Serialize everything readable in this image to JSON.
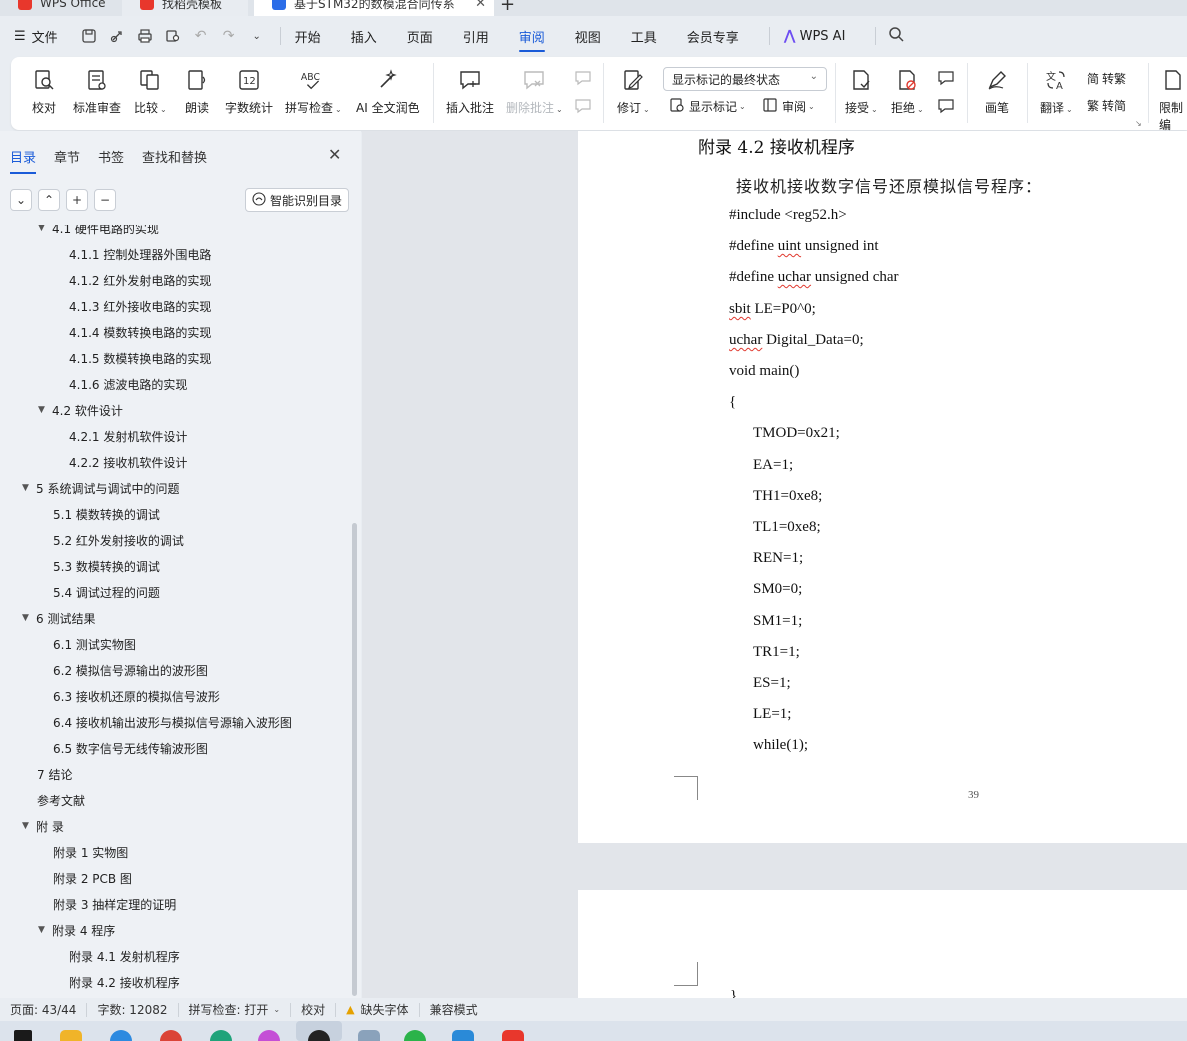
{
  "titlebar": {
    "tabs": [
      {
        "label": "WPS Office",
        "color": "#e8372c"
      },
      {
        "label": "找稻壳模板",
        "color": "#e8372c"
      },
      {
        "label": "基于STM32的数模混合同传系",
        "color": "#2b6de8"
      }
    ],
    "new_tab_symbol": "+"
  },
  "menubar": {
    "file_label": "文件",
    "items": [
      "开始",
      "插入",
      "页面",
      "引用",
      "审阅",
      "视图",
      "工具",
      "会员专享"
    ],
    "active_item": "审阅",
    "ai_label": "WPS AI"
  },
  "ribbon": {
    "buttons": {
      "proofread": "校对",
      "mark_review": "标准审查",
      "compare": "比较",
      "read_aloud": "朗读",
      "word_count": "字数统计",
      "spell_check": "拼写检查",
      "ai_polish": "AI 全文润色",
      "insert_comment": "插入批注",
      "delete_comment": "删除批注",
      "track_changes": "修订",
      "show_markup": "显示标记",
      "review": "审阅",
      "accept": "接受",
      "reject": "拒绝",
      "pen": "画笔",
      "translate": "翻译",
      "to_traditional": "转繁",
      "to_simplified": "转简",
      "restrict": "限制编"
    },
    "display_mode_value": "显示标记的最终状态"
  },
  "nav": {
    "tabs": [
      "目录",
      "章节",
      "书签",
      "查找和替换"
    ],
    "active_tab": "目录",
    "smart_button": "智能识别目录",
    "toc": [
      {
        "label": "4.1  硬件电路的实现",
        "level": 2,
        "expanded": true
      },
      {
        "label": "4.1.1  控制处理器外围电路",
        "level": 3
      },
      {
        "label": "4.1.2  红外发射电路的实现",
        "level": 3
      },
      {
        "label": "4.1.3  红外接收电路的实现",
        "level": 3
      },
      {
        "label": "4.1.4  模数转换电路的实现",
        "level": 3
      },
      {
        "label": "4.1.5 数模转换电路的实现",
        "level": 3
      },
      {
        "label": "4.1.6 滤波电路的实现",
        "level": 3
      },
      {
        "label": "4.2  软件设计",
        "level": 2,
        "expanded": true
      },
      {
        "label": "4.2.1  发射机软件设计",
        "level": 3
      },
      {
        "label": "4.2.2  接收机软件设计",
        "level": 3
      },
      {
        "label": "5  系统调试与调试中的问题",
        "level": 1,
        "expanded": true
      },
      {
        "label": "5.1  模数转换的调试",
        "level": 2
      },
      {
        "label": "5.2  红外发射接收的调试",
        "level": 2
      },
      {
        "label": "5.3  数模转换的调试",
        "level": 2
      },
      {
        "label": "5.4  调试过程的问题",
        "level": 2
      },
      {
        "label": "6  测试结果",
        "level": 1,
        "expanded": true
      },
      {
        "label": "6.1  测试实物图",
        "level": 2
      },
      {
        "label": "6.2  模拟信号源输出的波形图",
        "level": 2
      },
      {
        "label": "6.3  接收机还原的模拟信号波形",
        "level": 2
      },
      {
        "label": "6.4  接收机输出波形与模拟信号源输入波形图",
        "level": 2
      },
      {
        "label": "6.5  数字信号无线传输波形图",
        "level": 2
      },
      {
        "label": "7  结论",
        "level": 1
      },
      {
        "label": "参考文献",
        "level": 1
      },
      {
        "label": "附  录",
        "level": 1,
        "expanded": true
      },
      {
        "label": "附录 1  实物图",
        "level": 2
      },
      {
        "label": "附录 2    PCB 图",
        "level": 2
      },
      {
        "label": "附录 3  抽样定理的证明",
        "level": 2
      },
      {
        "label": "附录 4  程序",
        "level": 2,
        "expanded": true
      },
      {
        "label": "附录 4.1  发射机程序",
        "level": 3
      },
      {
        "label": "附录 4.2  接收机程序",
        "level": 3
      }
    ]
  },
  "document": {
    "heading": "附录 4.2  接收机程序",
    "intro": "接收机接收数字信号还原模拟信号程序：",
    "code_lines": [
      {
        "text": "#include <reg52.h>",
        "indent": 0
      },
      {
        "pre": "#define ",
        "squiggle": "uint",
        "post": " unsigned int",
        "indent": 0
      },
      {
        "pre": "#define ",
        "squiggle": "uchar",
        "post": " unsigned char",
        "indent": 0
      },
      {
        "pre": "",
        "squiggle": "sbit",
        "post": " LE=P0^0;",
        "indent": 0
      },
      {
        "pre": "",
        "squiggle": "uchar",
        "post": " Digital_Data=0;",
        "indent": 0
      },
      {
        "text": "void main()",
        "indent": 0
      },
      {
        "text": "{",
        "indent": 0
      },
      {
        "text": "TMOD=0x21;",
        "indent": 1
      },
      {
        "text": "EA=1;",
        "indent": 1
      },
      {
        "text": "TH1=0xe8;",
        "indent": 1
      },
      {
        "text": "TL1=0xe8;",
        "indent": 1
      },
      {
        "text": "REN=1;",
        "indent": 1
      },
      {
        "text": "SM0=0;",
        "indent": 1
      },
      {
        "text": "SM1=1;",
        "indent": 1
      },
      {
        "text": "TR1=1;",
        "indent": 1
      },
      {
        "text": "ES=1;",
        "indent": 1
      },
      {
        "text": "LE=1;",
        "indent": 1
      },
      {
        "text": "while(1);",
        "indent": 1
      }
    ],
    "page_number": "39",
    "next_page_fragment": "}"
  },
  "status": {
    "page": "页面: 43/44",
    "words": "字数: 12082",
    "spell_check": "拼写检查: 打开",
    "proofread": "校对",
    "missing_font": "缺失字体",
    "compat_mode": "兼容模式"
  },
  "colors": {
    "accent": "#1a5bd8",
    "squiggle": "#e0392f",
    "ai": "#6d4df2"
  }
}
